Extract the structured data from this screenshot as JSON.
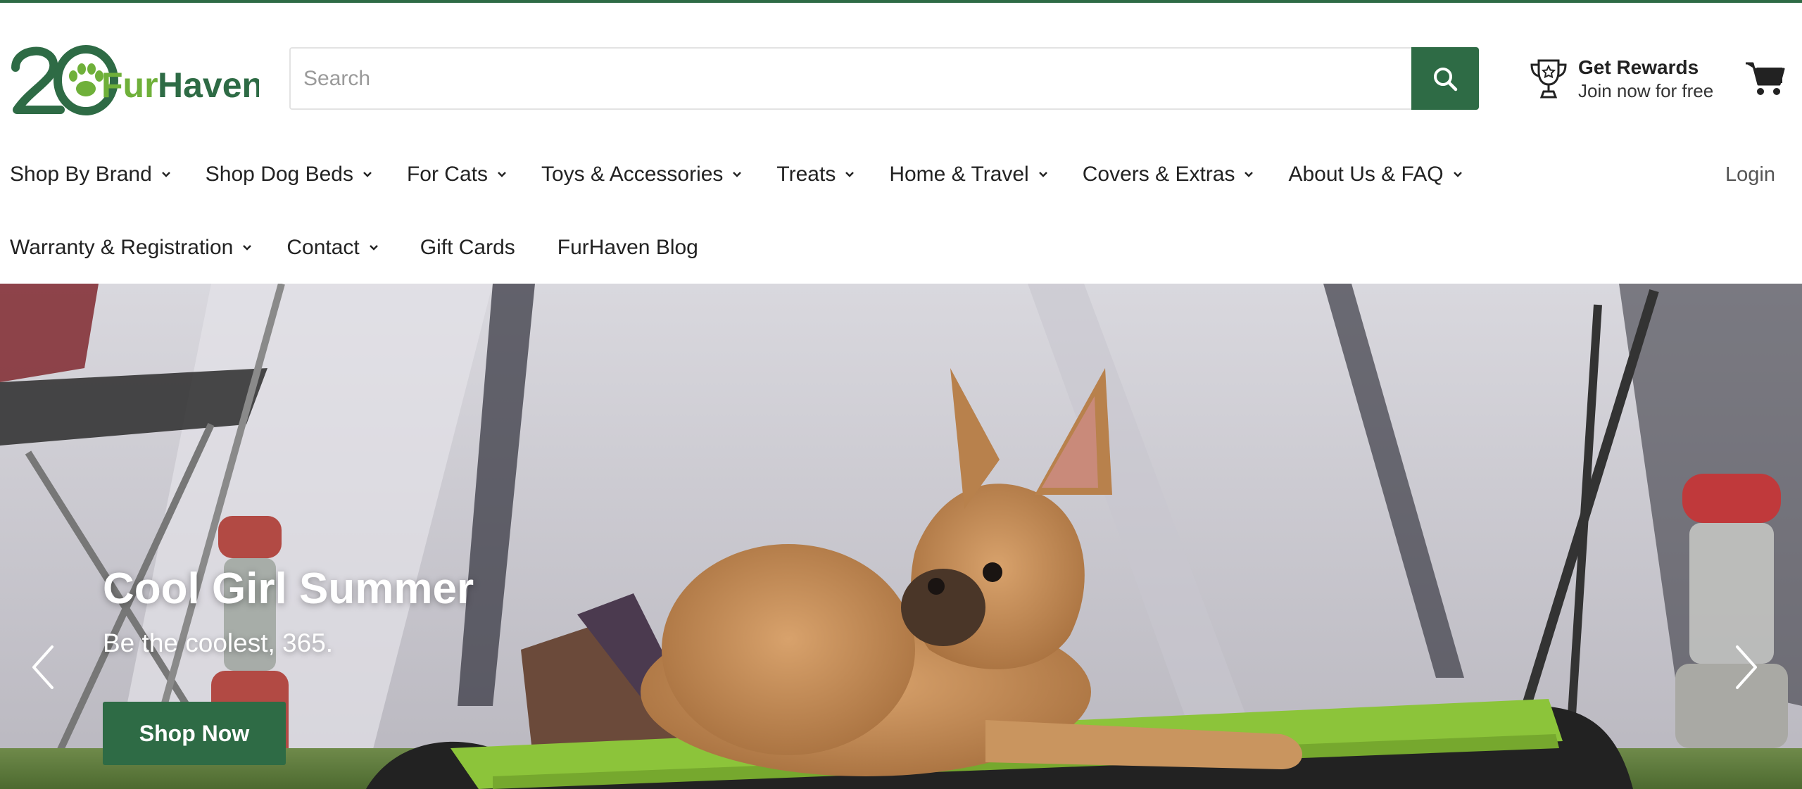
{
  "brand": {
    "logo_text": "FurHaven",
    "logo_badge": "20",
    "primary_color": "#2e6b45",
    "accent_color": "#6fb03a"
  },
  "search": {
    "placeholder": "Search",
    "button_icon": "search-icon"
  },
  "rewards": {
    "icon": "trophy-icon",
    "title": "Get Rewards",
    "subtitle": "Join now for free"
  },
  "cart": {
    "icon": "cart-icon"
  },
  "nav": {
    "row1": [
      {
        "label": "Shop By Brand",
        "dropdown": true
      },
      {
        "label": "Shop Dog Beds",
        "dropdown": true
      },
      {
        "label": "For Cats",
        "dropdown": true
      },
      {
        "label": "Toys & Accessories",
        "dropdown": true
      },
      {
        "label": "Treats",
        "dropdown": true
      },
      {
        "label": "Home & Travel",
        "dropdown": true
      },
      {
        "label": "Covers & Extras",
        "dropdown": true
      },
      {
        "label": "About Us & FAQ",
        "dropdown": true
      }
    ],
    "row2": [
      {
        "label": "Warranty & Registration",
        "dropdown": true
      },
      {
        "label": "Contact",
        "dropdown": true
      },
      {
        "label": "Gift Cards",
        "dropdown": false
      },
      {
        "label": "FurHaven Blog",
        "dropdown": false
      }
    ],
    "login_label": "Login"
  },
  "hero": {
    "title": "Cool Girl Summer",
    "subtitle": "Be the coolest, 365.",
    "cta_label": "Shop Now",
    "prev_icon": "chevron-left-icon",
    "next_icon": "chevron-right-icon"
  }
}
